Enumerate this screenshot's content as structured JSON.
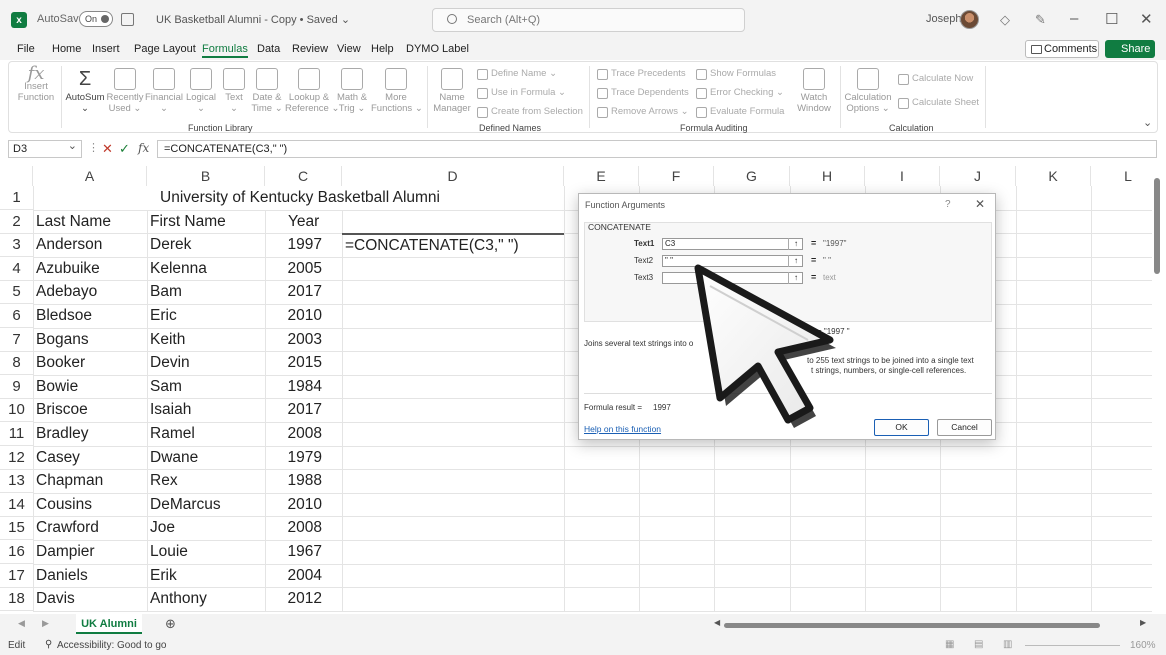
{
  "app": {
    "autosave_label": "AutoSave",
    "autosave_state": "On",
    "doc_title": "UK Basketball Alumni - Copy • Saved ⌄",
    "search_placeholder": "Search (Alt+Q)",
    "user_name": "Joseph"
  },
  "menu": {
    "items": [
      "File",
      "Home",
      "Insert",
      "Page Layout",
      "Formulas",
      "Data",
      "Review",
      "View",
      "Help",
      "DYMO Label"
    ],
    "active": "Formulas",
    "comments_label": "Comments",
    "share_label": "Share"
  },
  "ribbon": {
    "function_library": {
      "group_label": "Function Library",
      "buttons": [
        {
          "label": "Insert\nFunction"
        },
        {
          "label": "AutoSum\n⌄"
        },
        {
          "label": "Recently\nUsed ⌄"
        },
        {
          "label": "Financial\n⌄"
        },
        {
          "label": "Logical\n⌄"
        },
        {
          "label": "Text\n⌄"
        },
        {
          "label": "Date &\nTime ⌄"
        },
        {
          "label": "Lookup &\nReference ⌄"
        },
        {
          "label": "Math &\nTrig ⌄"
        },
        {
          "label": "More\nFunctions ⌄"
        }
      ]
    },
    "defined_names": {
      "group_label": "Defined Names",
      "name_manager": "Name\nManager",
      "define_name": "Define Name ⌄",
      "use_in_formula": "Use in Formula ⌄",
      "create_from_selection": "Create from Selection"
    },
    "formula_auditing": {
      "group_label": "Formula Auditing",
      "trace_precedents": "Trace Precedents",
      "trace_dependents": "Trace Dependents",
      "remove_arrows": "Remove Arrows ⌄",
      "show_formulas": "Show Formulas",
      "error_checking": "Error Checking ⌄",
      "evaluate_formula": "Evaluate Formula",
      "watch_window": "Watch\nWindow"
    },
    "calculation": {
      "group_label": "Calculation",
      "calc_options": "Calculation\nOptions ⌄",
      "calc_now": "Calculate Now",
      "calc_sheet": "Calculate Sheet"
    }
  },
  "formula_bar": {
    "name_box": "D3",
    "formula": "=CONCATENATE(C3,\" \")"
  },
  "columns": [
    "A",
    "B",
    "C",
    "D",
    "E",
    "F",
    "G",
    "H",
    "I",
    "J",
    "K",
    "L"
  ],
  "sheet": {
    "title": "University of Kentucky Basketball Alumni",
    "headers": [
      "Last Name",
      "First Name",
      "Year"
    ],
    "d3_formula": "=CONCATENATE(C3,\" \")",
    "rows": [
      [
        "Anderson",
        "Derek",
        "1997"
      ],
      [
        "Azubuike",
        "Kelenna",
        "2005"
      ],
      [
        "Adebayo",
        "Bam",
        "2017"
      ],
      [
        "Bledsoe",
        "Eric",
        "2010"
      ],
      [
        "Bogans",
        "Keith",
        "2003"
      ],
      [
        "Booker",
        "Devin",
        "2015"
      ],
      [
        "Bowie",
        "Sam",
        "1984"
      ],
      [
        "Briscoe",
        "Isaiah",
        "2017"
      ],
      [
        "Bradley",
        "Ramel",
        "2008"
      ],
      [
        "Casey",
        "Dwane",
        "1979"
      ],
      [
        "Chapman",
        "Rex",
        "1988"
      ],
      [
        "Cousins",
        "DeMarcus",
        "2010"
      ],
      [
        "Crawford",
        "Joe",
        "2008"
      ],
      [
        "Dampier",
        "Louie",
        "1967"
      ],
      [
        "Daniels",
        "Erik",
        "2004"
      ],
      [
        "Davis",
        "Anthony",
        "2012"
      ]
    ]
  },
  "dialog": {
    "title": "Function Arguments",
    "help_mark": "?",
    "close_mark": "✕",
    "function_name": "CONCATENATE",
    "args": [
      {
        "label": "Text1",
        "value": "C3",
        "result": "\"1997\""
      },
      {
        "label": "Text2",
        "value": "\" \"",
        "result": "\" \""
      },
      {
        "label": "Text3",
        "value": "",
        "result": "text"
      }
    ],
    "overall_result": "= \"1997 \"",
    "description": "Joins several text strings into o",
    "arg_help_1": "to 255 text strings to be joined into a single text",
    "arg_help_2": "t strings, numbers, or single-cell references.",
    "formula_result_label": "Formula result =",
    "formula_result_value": "1997",
    "help_link": "Help on this function",
    "ok_label": "OK",
    "cancel_label": "Cancel"
  },
  "sheet_tabs": {
    "active": "UK Alumni",
    "add_symbol": "⊕"
  },
  "status": {
    "mode": "Edit",
    "accessibility": "Accessibility: Good to go",
    "zoom": "160%"
  },
  "colors": {
    "accent": "#107c41",
    "link": "#1a5fb4"
  }
}
